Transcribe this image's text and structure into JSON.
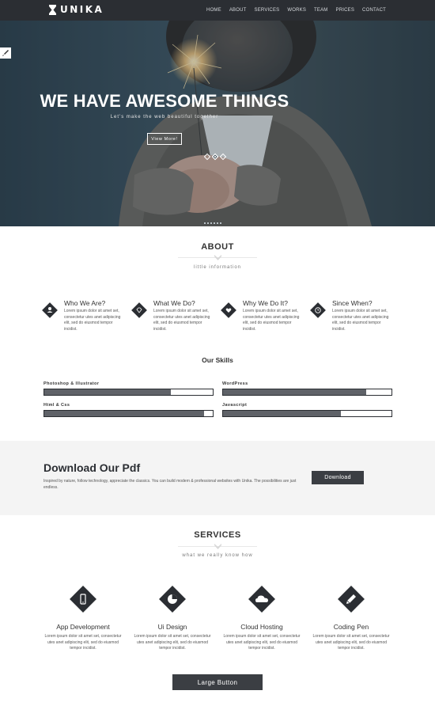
{
  "nav": {
    "logo_text": "UNIKA",
    "items": [
      "HOME",
      "ABOUT",
      "SERVICES",
      "WORKS",
      "TEAM",
      "PRICES",
      "CONTACT"
    ]
  },
  "hero": {
    "title": "WE HAVE AWESOME THINGS",
    "subtitle": "Let's make the web beautiful together",
    "button": "View More!"
  },
  "about": {
    "title": "ABOUT",
    "subtitle": "little information",
    "features": [
      {
        "title": "Who We Are?",
        "text": "Lorem ipsum dolor sit amet set, consectetur utes anet adipiscing elit, sed do eiusmod tempor incidist.",
        "icon": "team-icon"
      },
      {
        "title": "What We Do?",
        "text": "Lorem ipsum dolor sit amet set, consectetur utes anet adipiscing elit, sed do eiusmod tempor incidist.",
        "icon": "diamond-gem-icon"
      },
      {
        "title": "Why We Do It?",
        "text": "Lorem ipsum dolor sit amet set, consectetur utes anet adipiscing elit, sed do eiusmod tempor incidist.",
        "icon": "heart-icon"
      },
      {
        "title": "Since When?",
        "text": "Lorem ipsum dolor sit amet set, consectetur utes anet adipiscing elit, sed do eiusmod tempor incidist.",
        "icon": "clock-icon"
      }
    ]
  },
  "skills": {
    "title": "Our Skills",
    "items": [
      {
        "label": "Photoshop & Illustrator",
        "level": 0.75
      },
      {
        "label": "WordPress",
        "level": 0.85
      },
      {
        "label": "Html & Css",
        "level": 0.95
      },
      {
        "label": "Javascript",
        "level": 0.7
      }
    ]
  },
  "download": {
    "title": "Download Our Pdf",
    "text": "Inspired by nature, follow technology, appreciate the classics. You can build modern & professional websites with Unika. The possibilities are just endless.",
    "button": "Download"
  },
  "services": {
    "title": "SERVICES",
    "subtitle": "what we really know how",
    "items": [
      {
        "title": "App Development",
        "text": "Lorem ipsum dolor sit amet set, consectetur utes anet adipiscing elit, sed do eiusmod tempor incidist.",
        "icon": "mobile-phone-icon"
      },
      {
        "title": "Ui Design",
        "text": "Lorem ipsum dolor sit amet set, consectetur utes anet adipiscing elit, sed do eiusmod tempor incidist.",
        "icon": "pie-chart-icon"
      },
      {
        "title": "Cloud Hosting",
        "text": "Lorem ipsum dolor sit amet set, consectetur utes anet adipiscing elit, sed do eiusmod tempor incidist.",
        "icon": "cloud-icon"
      },
      {
        "title": "Coding Pen",
        "text": "Lorem ipsum dolor sit amet set, consectetur utes anet adipiscing elit, sed do eiusmod tempor incidist.",
        "icon": "pen-icon"
      }
    ],
    "large_button": "Large Button"
  },
  "colors": {
    "nav_bg": "#2b2e33",
    "accent_dark": "#3b3e43",
    "skill_fill": "#5f6268",
    "section_alt_bg": "#f4f4f4"
  }
}
